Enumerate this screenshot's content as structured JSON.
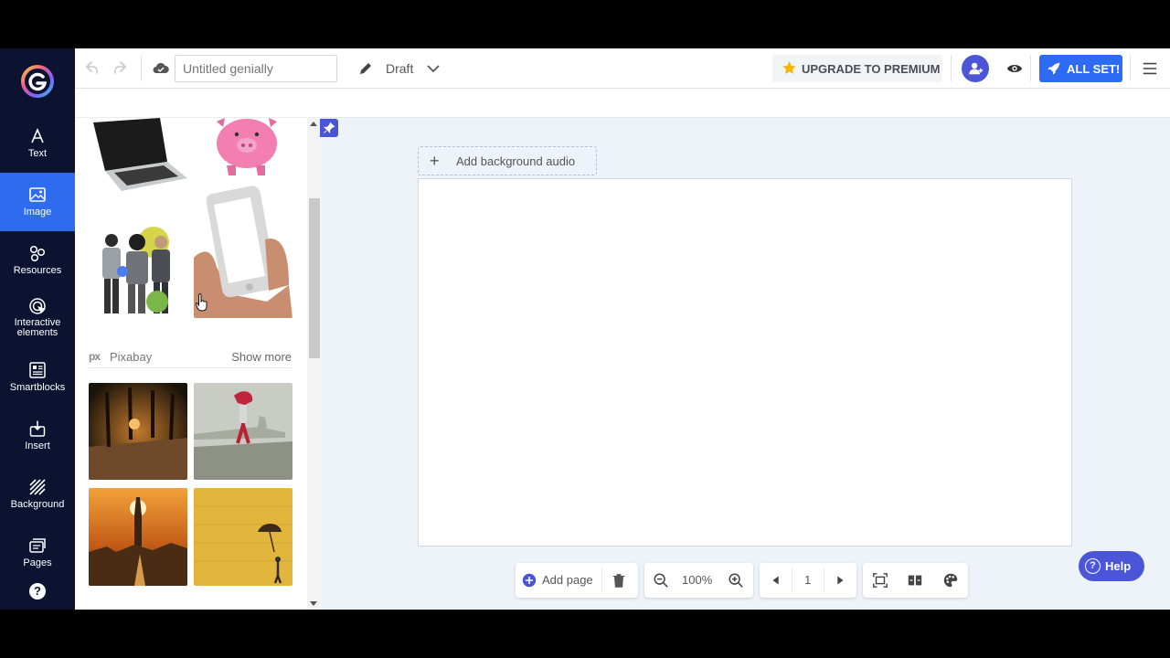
{
  "sidebar": {
    "items": [
      {
        "label": "Text",
        "icon": "text-icon"
      },
      {
        "label": "Image",
        "icon": "image-icon",
        "active": true
      },
      {
        "label": "Resources",
        "icon": "resources-icon"
      },
      {
        "label": "Interactive elements",
        "icon": "interactive-icon"
      },
      {
        "label": "Smartblocks",
        "icon": "smartblocks-icon"
      },
      {
        "label": "Insert",
        "icon": "insert-icon"
      },
      {
        "label": "Background",
        "icon": "background-icon"
      },
      {
        "label": "Pages",
        "icon": "pages-icon"
      }
    ],
    "help_glyph": "?"
  },
  "topbar": {
    "title_placeholder": "Untitled genially",
    "title_value": "",
    "status": "Draft",
    "upgrade_label": "UPGRADE TO PREMIUM",
    "allset_label": "ALL SET!"
  },
  "panel": {
    "source_logo": "px",
    "source_name": "Pixabay",
    "show_more": "Show more"
  },
  "editor": {
    "add_audio": "Add background audio",
    "add_audio_plus": "+"
  },
  "bottom_toolbar": {
    "add_page": "Add page",
    "zoom": "100%",
    "page_number": "1"
  },
  "help": {
    "label": "Help",
    "glyph": "?"
  },
  "colors": {
    "nav_bg": "#0b1330",
    "nav_active": "#2f6bef",
    "accent": "#4a55d8",
    "allset": "#2d6cf2",
    "workspace": "#eef2f9"
  }
}
